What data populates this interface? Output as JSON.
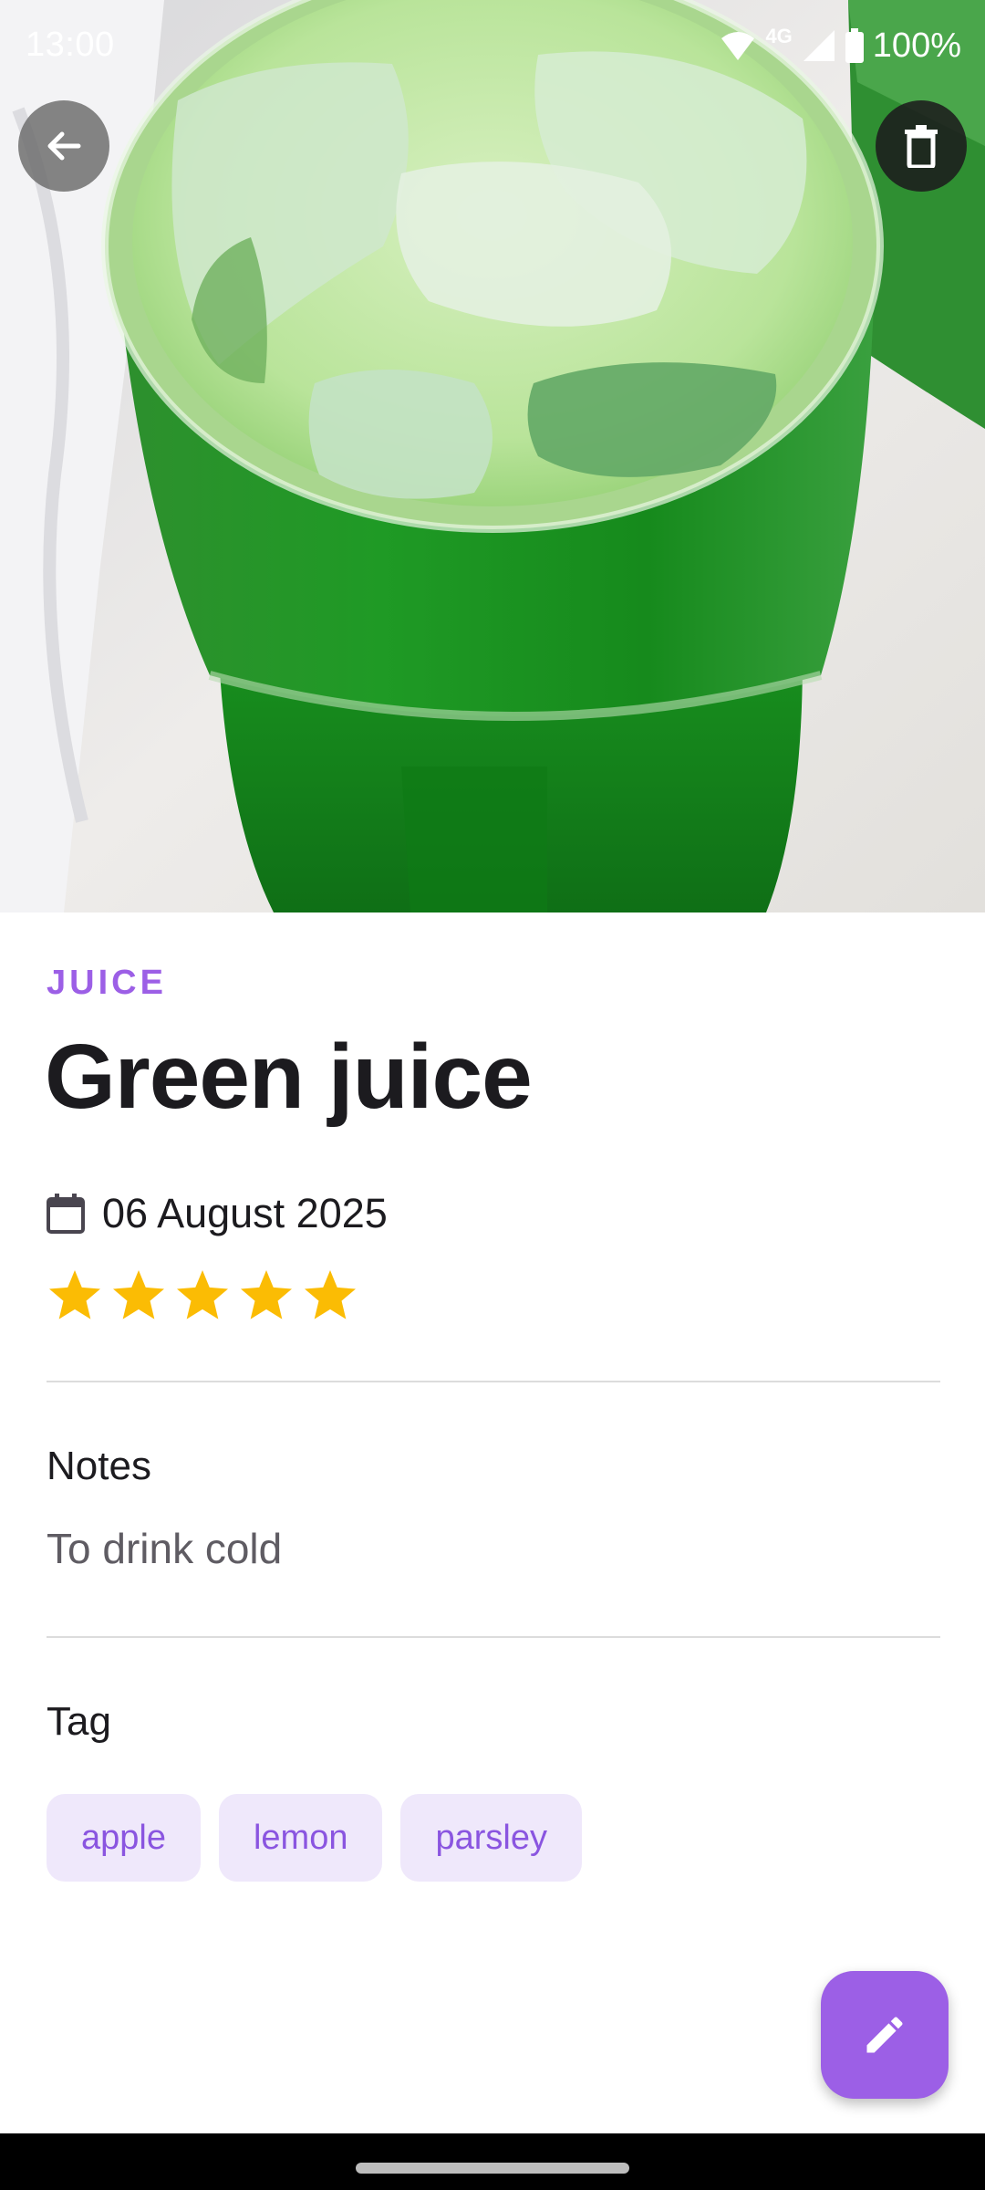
{
  "status_bar": {
    "time": "13:00",
    "network": "4G",
    "battery": "100%"
  },
  "header": {
    "back_icon": "arrow-back-icon",
    "delete_icon": "trash-icon"
  },
  "item": {
    "category": "JUICE",
    "title": "Green juice",
    "date": "06 August 2025",
    "rating": 5,
    "rating_max": 5
  },
  "notes": {
    "label": "Notes",
    "text": "To drink cold"
  },
  "tags": {
    "label": "Tag",
    "items": [
      "apple",
      "lemon",
      "parsley"
    ]
  },
  "fab": {
    "icon": "pencil-edit-icon"
  },
  "colors": {
    "accent": "#9c5fe6",
    "chip_bg": "#efe8fb",
    "star": "#fbbc04"
  }
}
